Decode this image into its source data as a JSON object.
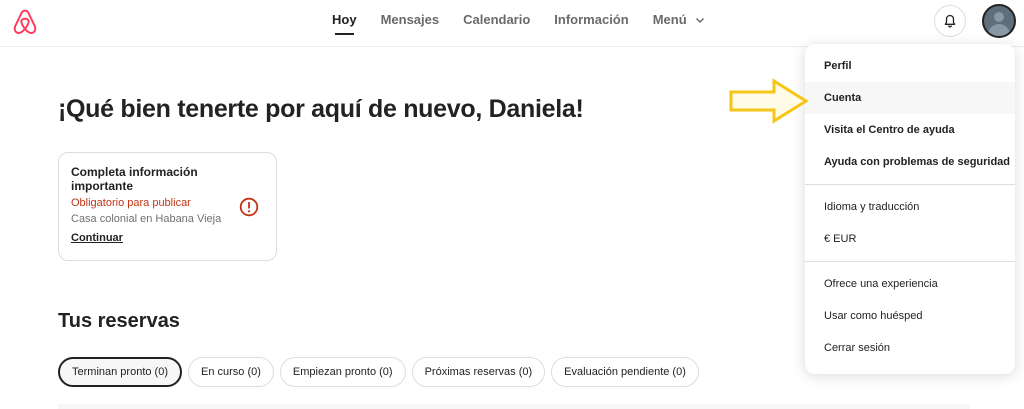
{
  "header": {
    "logo": "airbnb-logo",
    "nav": [
      {
        "label": "Hoy",
        "active": true
      },
      {
        "label": "Mensajes",
        "active": false
      },
      {
        "label": "Calendario",
        "active": false
      },
      {
        "label": "Información",
        "active": false
      },
      {
        "label": "Menú",
        "active": false
      }
    ],
    "icons": {
      "bell": "bell-icon",
      "avatar": "user-avatar"
    }
  },
  "main": {
    "greeting": "¡Qué bien tenerte por aquí de nuevo, Daniela!",
    "card": {
      "title": "Completa información importante",
      "required": "Obligatorio para publicar",
      "place": "Casa colonial en Habana Vieja",
      "link": "Continuar"
    },
    "reservations": {
      "title": "Tus reservas",
      "tabs": [
        {
          "label": "Terminan pronto (0)",
          "active": true
        },
        {
          "label": "En curso (0)",
          "active": false
        },
        {
          "label": "Empiezan pronto (0)",
          "active": false
        },
        {
          "label": "Próximas reservas (0)",
          "active": false
        },
        {
          "label": "Evaluación pendiente (0)",
          "active": false
        }
      ]
    }
  },
  "menu": {
    "section1": [
      "Perfil",
      "Cuenta",
      "Visita el Centro de ayuda",
      "Ayuda con problemas de seguridad"
    ],
    "section2": [
      "Idioma y traducción",
      "€ EUR"
    ],
    "section3": [
      "Ofrece una experiencia",
      "Usar como huésped",
      "Cerrar sesión"
    ]
  },
  "colors": {
    "brand": "#ff385c",
    "warning": "#c13515",
    "annotation_arrow": "#f5c518"
  }
}
